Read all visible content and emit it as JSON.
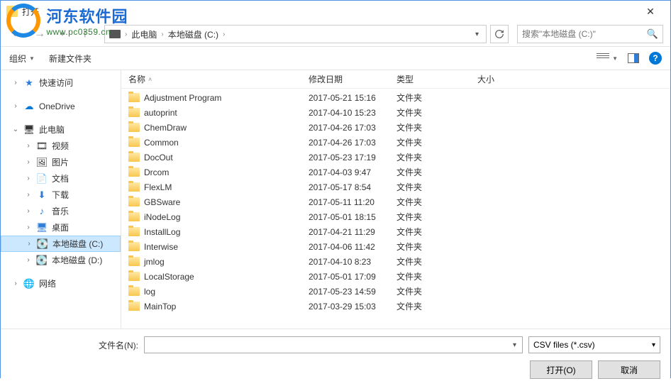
{
  "window": {
    "title": "打开"
  },
  "watermark": {
    "cn": "河东软件园",
    "url": "www.pc0359.cn"
  },
  "breadcrumbs": {
    "root": "此电脑",
    "drive": "本地磁盘 (C:)"
  },
  "search": {
    "placeholder": "搜索\"本地磁盘 (C:)\""
  },
  "toolbar": {
    "organize": "组织",
    "newfolder": "新建文件夹"
  },
  "sidebar": {
    "quick": "快速访问",
    "onedrive": "OneDrive",
    "thispc": "此电脑",
    "videos": "视频",
    "pictures": "图片",
    "documents": "文档",
    "downloads": "下载",
    "music": "音乐",
    "desktop": "桌面",
    "drivec": "本地磁盘 (C:)",
    "drived": "本地磁盘 (D:)",
    "network": "网络"
  },
  "columns": {
    "name": "名称",
    "date": "修改日期",
    "type": "类型",
    "size": "大小"
  },
  "foldertype": "文件夹",
  "files": [
    {
      "name": "Adjustment Program",
      "date": "2017-05-21 15:16"
    },
    {
      "name": "autoprint",
      "date": "2017-04-10 15:23"
    },
    {
      "name": "ChemDraw",
      "date": "2017-04-26 17:03"
    },
    {
      "name": "Common",
      "date": "2017-04-26 17:03"
    },
    {
      "name": "DocOut",
      "date": "2017-05-23 17:19"
    },
    {
      "name": "Drcom",
      "date": "2017-04-03 9:47"
    },
    {
      "name": "FlexLM",
      "date": "2017-05-17 8:54"
    },
    {
      "name": "GBSware",
      "date": "2017-05-11 11:20"
    },
    {
      "name": "iNodeLog",
      "date": "2017-05-01 18:15"
    },
    {
      "name": "InstallLog",
      "date": "2017-04-21 11:29"
    },
    {
      "name": "Interwise",
      "date": "2017-04-06 11:42"
    },
    {
      "name": "jmlog",
      "date": "2017-04-10 8:23"
    },
    {
      "name": "LocalStorage",
      "date": "2017-05-01 17:09"
    },
    {
      "name": "log",
      "date": "2017-05-23 14:59"
    },
    {
      "name": "MainTop",
      "date": "2017-03-29 15:03"
    }
  ],
  "footer": {
    "filelabel": "文件名(N):",
    "filter": "CSV files (*.csv)",
    "open": "打开(O)",
    "cancel": "取消"
  }
}
